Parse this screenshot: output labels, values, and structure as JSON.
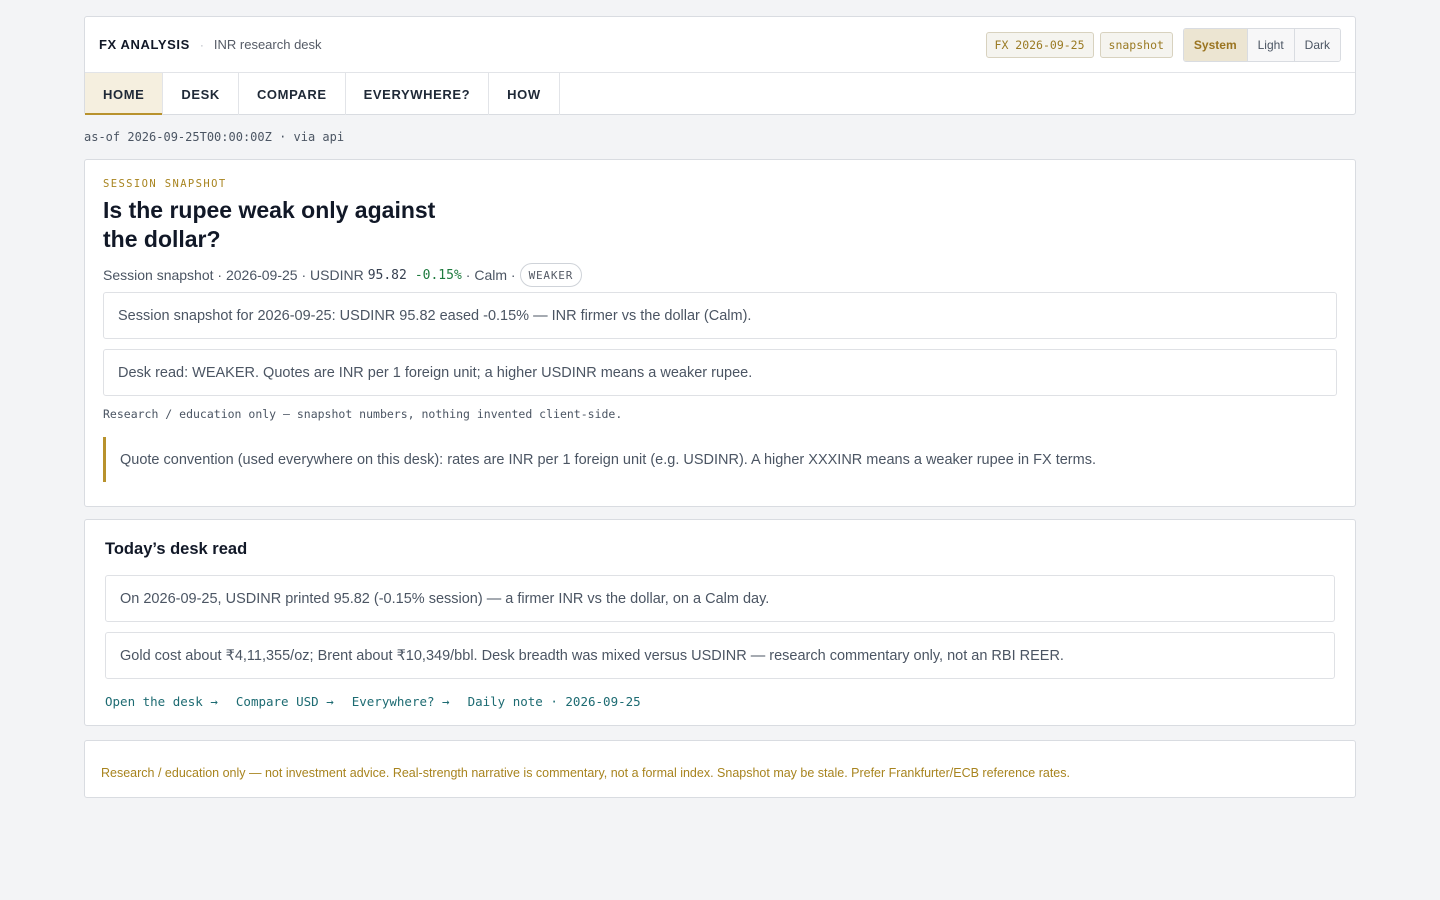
{
  "header": {
    "brand": "FX ANALYSIS",
    "separator": "·",
    "subtitle": "INR research desk",
    "date_pill": "FX 2026-09-25",
    "source_pill": "snapshot",
    "theme_options": [
      "System",
      "Light",
      "Dark"
    ],
    "active_theme": "System"
  },
  "tabs": [
    {
      "label": "HOME",
      "active": true
    },
    {
      "label": "DESK",
      "active": false
    },
    {
      "label": "COMPARE",
      "active": false
    },
    {
      "label": "EVERYWHERE?",
      "active": false
    },
    {
      "label": "HOW",
      "active": false
    }
  ],
  "asof": "as-of 2026-09-25T00:00:00Z · via api",
  "snapshot": {
    "eyebrow": "SESSION SNAPSHOT",
    "headline": "Is the rupee weak only against the dollar?",
    "meta_prefix": "Session snapshot · 2026-09-25 · USDINR",
    "rate": "95.82",
    "change": "-0.15%",
    "meta_suffix": "· Calm ·",
    "badge": "WEAKER",
    "summary": "Session snapshot for 2026-09-25: USDINR 95.82 eased -0.15% — INR firmer vs the dollar (Calm).",
    "desk_read": "Desk read: WEAKER. Quotes are INR per 1 foreign unit; a higher USDINR means a weaker rupee.",
    "research_note": "Research / education only — snapshot numbers, nothing invented client-side.",
    "quote_convention": "Quote convention (used everywhere on this desk): rates are INR per 1 foreign unit (e.g. USDINR). A higher XXXINR means a weaker rupee in FX terms."
  },
  "desk_read_card": {
    "title": "Today’s desk read",
    "line1": "On 2026-09-25, USDINR printed 95.82 (-0.15% session) — a firmer INR vs the dollar, on a Calm day.",
    "line2": "Gold cost about ₹4,11,355/oz; Brent about ₹10,349/bbl. Desk breadth was mixed versus USDINR — research commentary only, not an RBI REER.",
    "links": [
      "Open the desk →",
      "Compare USD →",
      "Everywhere? →",
      "Daily note · 2026-09-25"
    ]
  },
  "footer": {
    "text": "Research / education only — not investment advice. Real-strength narrative is commentary, not a formal index. Snapshot may be stale. Prefer Frankfurter/ECB reference rates."
  },
  "colors": {
    "accent": "#b8922d",
    "positive": "#1e7a3e",
    "link": "#1d6b72"
  }
}
